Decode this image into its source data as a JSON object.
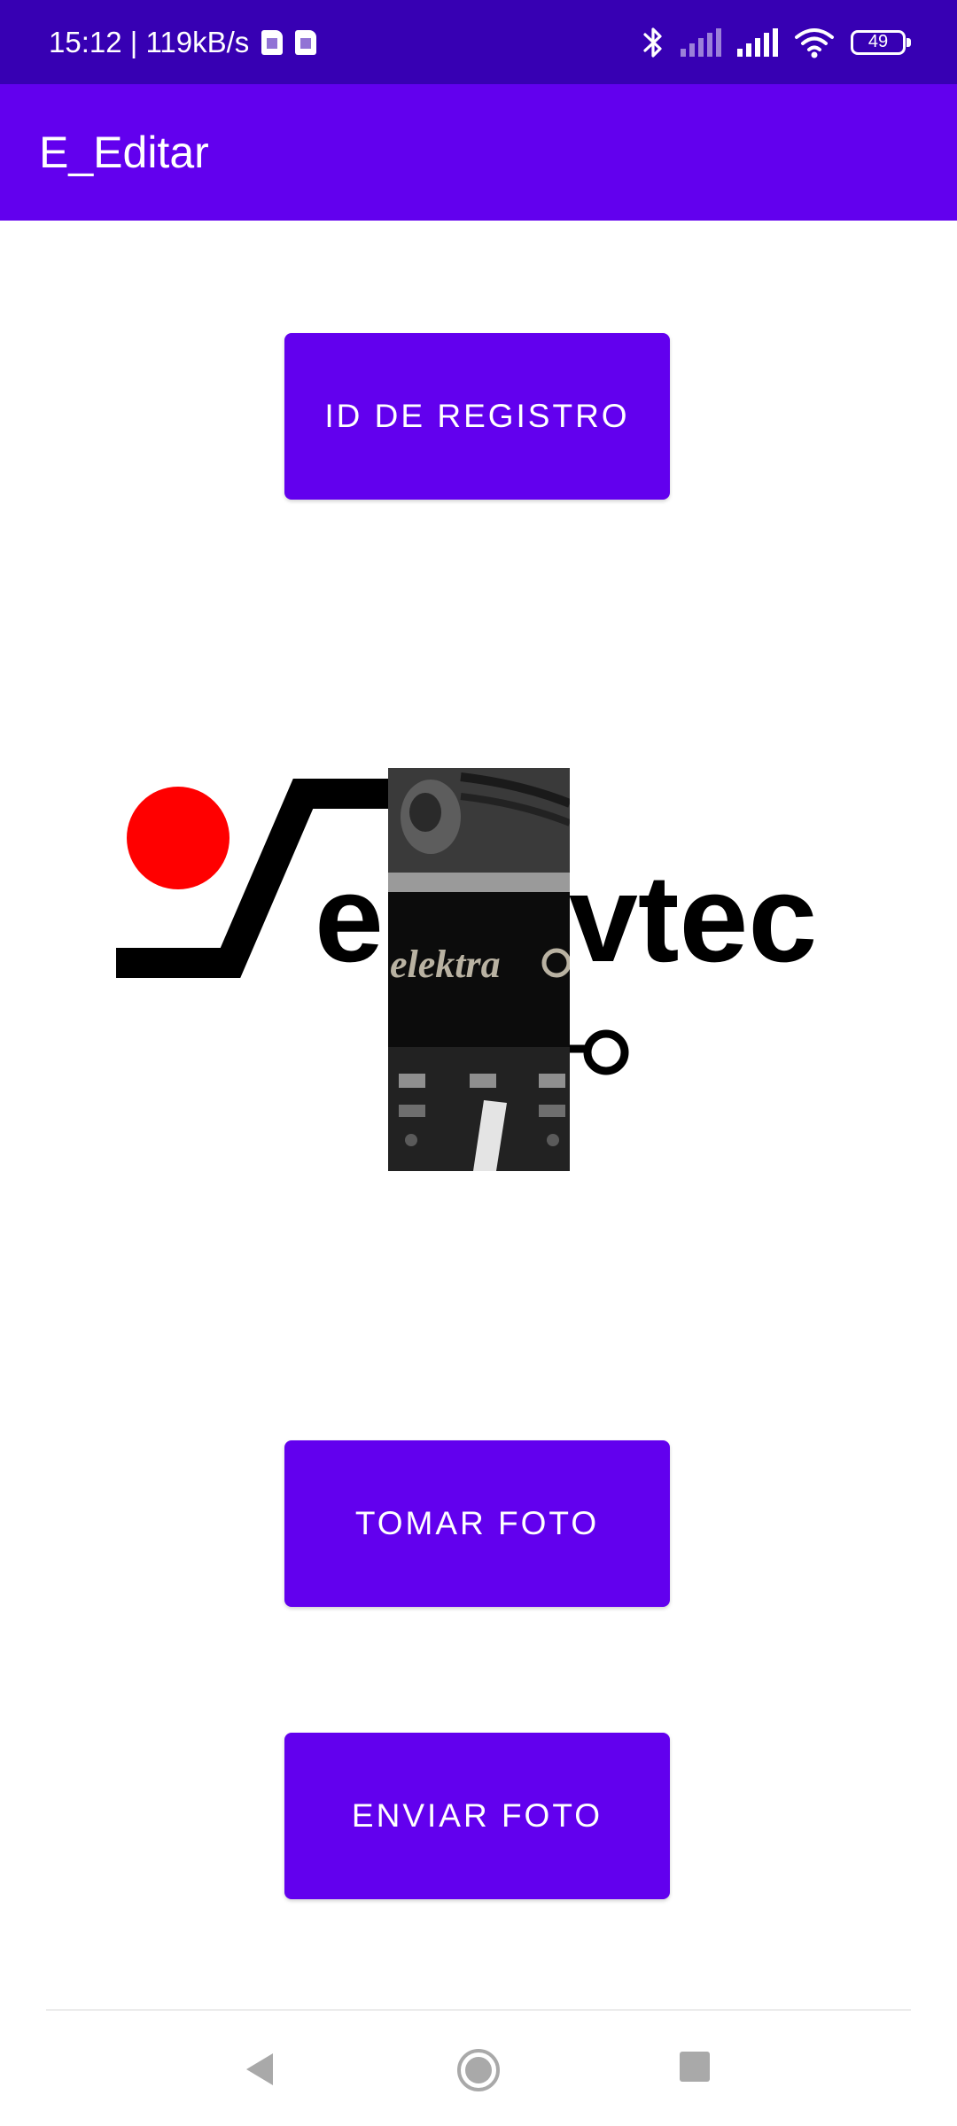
{
  "status_bar": {
    "time_speed": "15:12 | 119kB/s",
    "battery_level": "49",
    "icons": [
      "sim-icon",
      "sim-icon",
      "bluetooth-icon",
      "signal-icon",
      "signal-icon",
      "wifi-icon",
      "battery-icon"
    ]
  },
  "app_bar": {
    "title": "E_Editar"
  },
  "buttons": {
    "record_id": "ID DE REGISTRO",
    "take_photo": "TOMAR FOTO",
    "send_photo": "ENVIAR FOTO"
  },
  "logo": {
    "text_left": "e",
    "text_right": "vtec",
    "photo_text": "elektra"
  },
  "colors": {
    "primary": "#6200EE",
    "primary_dark": "#3700B3",
    "logo_red": "#FF0000",
    "logo_black": "#000000"
  },
  "nav": {
    "icons": [
      "back-icon",
      "home-icon",
      "recents-icon"
    ]
  }
}
